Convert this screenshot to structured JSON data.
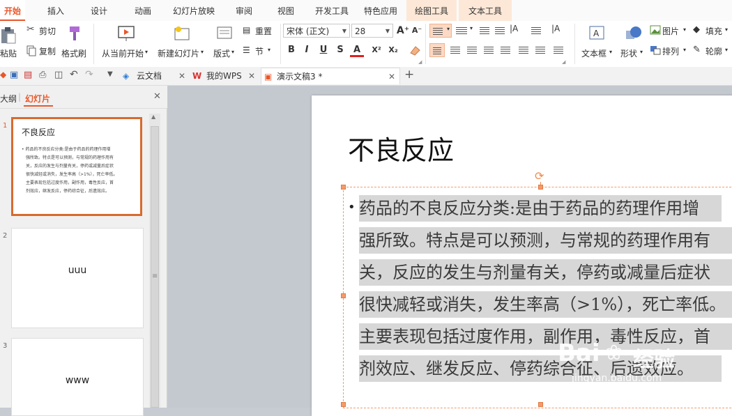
{
  "tabs": [
    "开始",
    "插入",
    "设计",
    "动画",
    "幻灯片放映",
    "审阅",
    "视图",
    "开发工具",
    "特色应用",
    "绘图工具",
    "文本工具"
  ],
  "ribbon": {
    "paste": "粘贴",
    "cut": "剪切",
    "copy": "复制",
    "format_painter": "格式刷",
    "from_current": "从当前开始",
    "new_slide": "新建幻灯片",
    "layout": "版式",
    "reset": "重置",
    "section": "节",
    "font_name": "宋体 (正文)",
    "font_size": "28",
    "bold": "B",
    "italic": "I",
    "underline": "U",
    "strike": "S",
    "font_color": "A",
    "superscript": "X²",
    "subscript": "X₂",
    "grow_font": "A⁺",
    "shrink_font": "A⁻",
    "textbox": "文本框",
    "shape": "形状",
    "picture": "图片",
    "fill": "填充",
    "arrange": "排列",
    "outline": "轮廓"
  },
  "doc_tabs": [
    {
      "label": "云文档"
    },
    {
      "label": "我的WPS"
    },
    {
      "label": "演示文稿3 *"
    }
  ],
  "panel": {
    "tab_outline": "大纲",
    "tab_slides": "幻灯片"
  },
  "thumbnails": [
    {
      "num": "1",
      "title": "不良反应",
      "lines": [
        "• 药品的不良反应分类:是由于药品的药理作用增",
        "强所致。特点是可以预测，与常规的药理作用有",
        "关，反应的发生与剂量有关，停药或减量后症状",
        "很快减轻或消失，发生率高（>1%），死亡率低。",
        "主要表现包括过度作用，副作用，毒性反应，首",
        "剂效应，继发反应，停药综合征，后遗效应。"
      ]
    },
    {
      "num": "2",
      "text": "uuu"
    },
    {
      "num": "3",
      "text": "www"
    }
  ],
  "slide": {
    "title": "不良反应",
    "bullet": "•",
    "body_lines": [
      "药品的不良反应分类:是由于药品的药理作用增",
      "强所致。特点是可以预测，与常规的药理作用有",
      "关，反应的发生与剂量有关，停药或减量后症状",
      "很快减轻或消失，发生率高（>1%），死亡率低。",
      "主要表现包括过度作用，副作用，毒性反应，首",
      "剂效应、继发反应、停药综合征、后遗效应。"
    ]
  },
  "watermark": {
    "brand": "Bai",
    "brand2": "经验",
    "url": "jingyan.baidu.com"
  },
  "colors": {
    "accent": "#e8572a",
    "selection": "#d7d7d7",
    "handle": "#f29b6b"
  }
}
